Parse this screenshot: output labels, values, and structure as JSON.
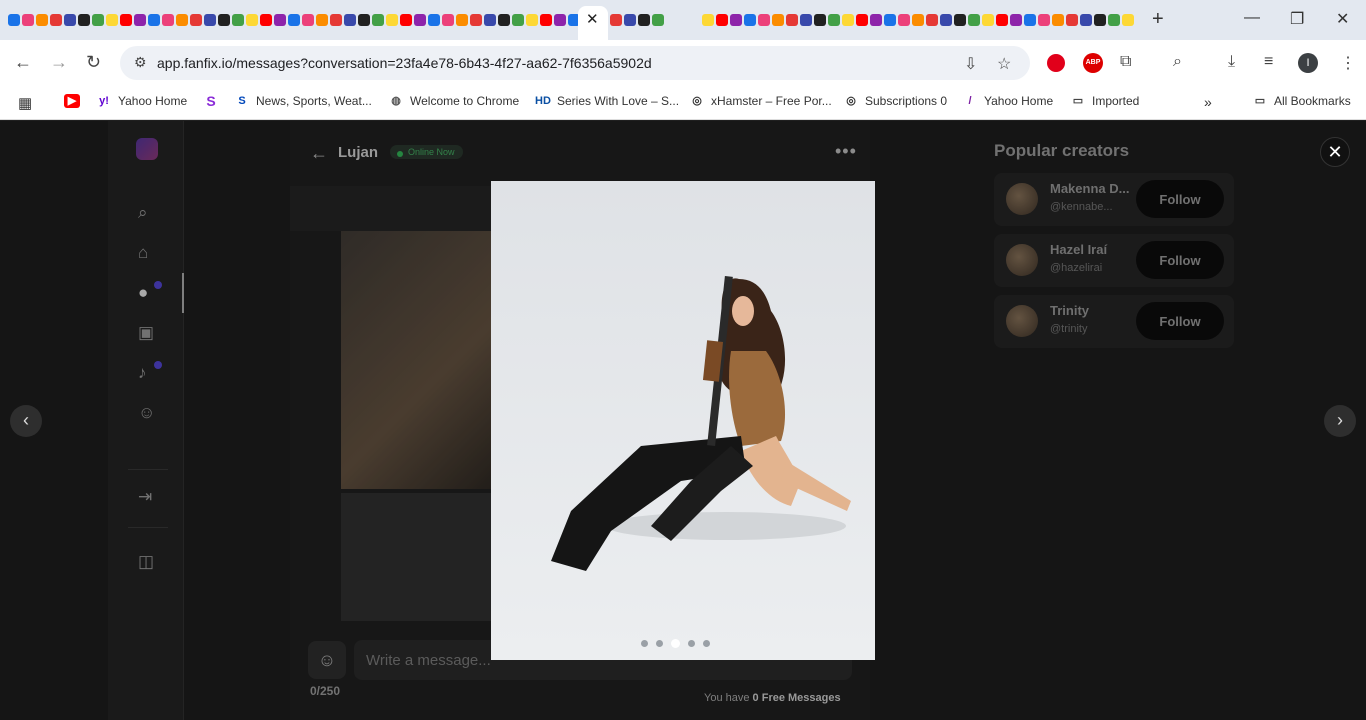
{
  "browser": {
    "tab_close": "✕",
    "new_tab": "+",
    "url": "app.fanfix.io/messages?conversation=23fa4e78-6b43-4f27-aa62-7f6356a5902d",
    "profile_initial": "I",
    "ext_abp": "ABP"
  },
  "bookmarks": [
    {
      "label": "Yahoo Home",
      "icon": "y!",
      "color": "#5f01d1"
    },
    {
      "label": "News, Sports, Weat...",
      "icon": "S",
      "color": "#0047ba"
    },
    {
      "label": "Welcome to Chrome",
      "icon": "◍",
      "color": "#555555"
    },
    {
      "label": "Series With Love – S...",
      "icon": "HD",
      "color": "#0a4fa3"
    },
    {
      "label": "xHamster – Free Por...",
      "icon": "◎",
      "color": "#333333"
    },
    {
      "label": "Subscriptions 0",
      "icon": "◎",
      "color": "#333333"
    },
    {
      "label": "Yahoo Home",
      "icon": "/",
      "color": "#7b1fa2"
    },
    {
      "label": "Imported",
      "icon": "▭",
      "color": "#444444"
    }
  ],
  "bookmarks_all": "All Bookmarks",
  "chat": {
    "name": "Lujan",
    "status": "Online Now",
    "input_placeholder": "Write a message...",
    "counter": "0/250",
    "free_prefix": "You have",
    "free_value": "0 Free Messages"
  },
  "popular": {
    "title": "Popular creators",
    "follow_label": "Follow",
    "creators": [
      {
        "name": "Makenna D...",
        "handle": "@kennabe..."
      },
      {
        "name": "Hazel Iraí",
        "handle": "@hazelirai"
      },
      {
        "name": "Trinity",
        "handle": "@trinity"
      }
    ]
  },
  "lightbox": {
    "close": "✕",
    "prev": "‹",
    "next": "›",
    "slide_count": 5,
    "active_slide": 3
  },
  "icons": {
    "search": "search-icon",
    "home": "home-icon",
    "messages": "chat-icon",
    "gallery": "image-icon",
    "notifications": "bell-icon",
    "profile": "user-icon",
    "logout": "logout-icon",
    "panel": "panel-icon"
  }
}
